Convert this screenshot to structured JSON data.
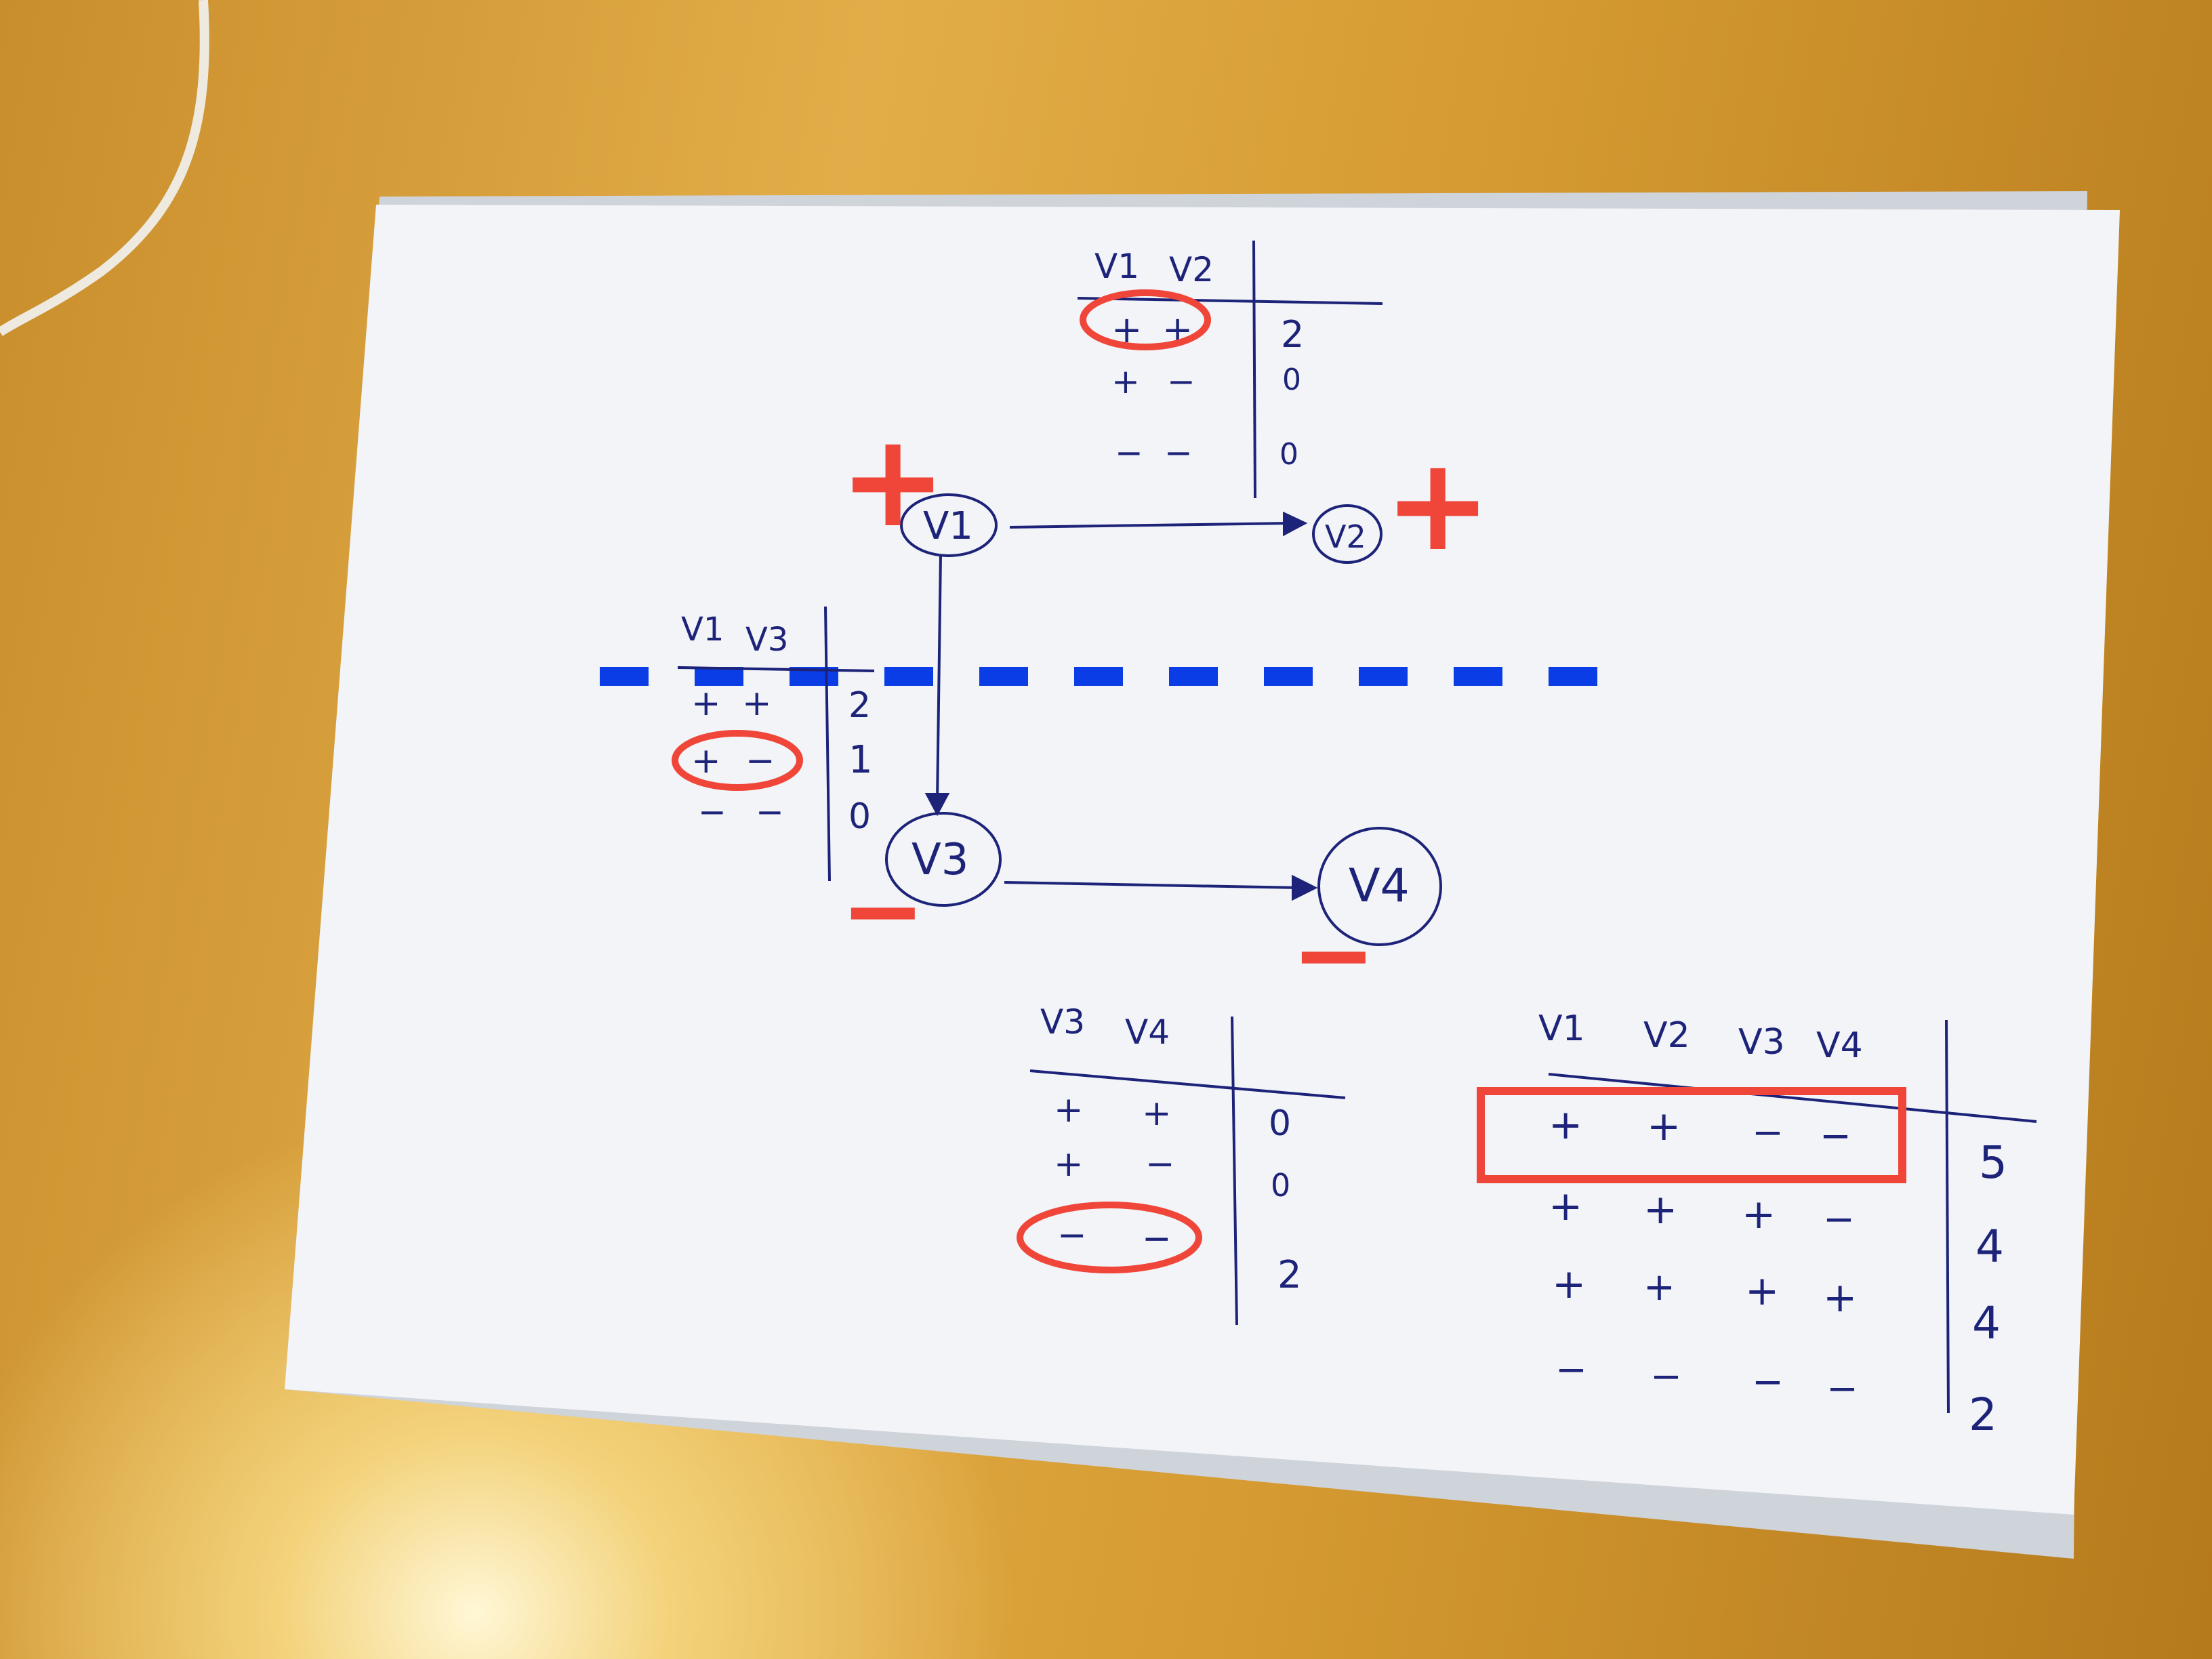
{
  "graph": {
    "nodes": [
      {
        "id": "v1",
        "label": "V1",
        "sign": "+"
      },
      {
        "id": "v2",
        "label": "V2",
        "sign": "+"
      },
      {
        "id": "v3",
        "label": "V3",
        "sign": "−"
      },
      {
        "id": "v4",
        "label": "V4",
        "sign": "−"
      }
    ],
    "edges": [
      [
        "v1",
        "v2"
      ],
      [
        "v1",
        "v3"
      ],
      [
        "v3",
        "v4"
      ]
    ]
  },
  "tables": {
    "v1v2": {
      "headers": [
        "V1",
        "V2"
      ],
      "rows": [
        [
          "+",
          "+",
          "2"
        ],
        [
          "+",
          "−",
          "0"
        ],
        [
          "−",
          "−",
          "0"
        ]
      ],
      "highlighted_row": 0
    },
    "v1v3": {
      "headers": [
        "V1",
        "V3"
      ],
      "rows": [
        [
          "+",
          "+",
          "2"
        ],
        [
          "+",
          "−",
          "1"
        ],
        [
          "−",
          "−",
          "0"
        ]
      ],
      "highlighted_row": 1
    },
    "v3v4": {
      "headers": [
        "V3",
        "V4"
      ],
      "rows": [
        [
          "+",
          "+",
          "0"
        ],
        [
          "+",
          "−",
          "0"
        ],
        [
          "−",
          "−",
          "2"
        ]
      ],
      "highlighted_row": 2
    },
    "full": {
      "headers": [
        "V1",
        "V2",
        "V3",
        "V4"
      ],
      "rows": [
        [
          "+",
          "+",
          "−",
          "−",
          "5"
        ],
        [
          "+",
          "+",
          "+",
          "−",
          "4"
        ],
        [
          "+",
          "+",
          "+",
          "+",
          "4"
        ],
        [
          "−",
          "−",
          "−",
          "−",
          "2"
        ]
      ],
      "highlighted_row": 0
    }
  },
  "colors": {
    "ink": "#1d2378",
    "annotation_red": "#f0463a",
    "cut_blue": "#0a3de6",
    "paper": "#f2f4f8",
    "table": "#d9a441"
  }
}
